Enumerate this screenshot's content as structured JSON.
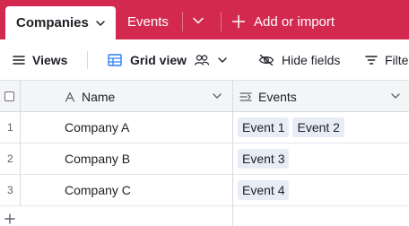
{
  "tabs": {
    "active_label": "Companies",
    "second_label": "Events",
    "add_import_label": "Add or import"
  },
  "toolbar": {
    "views_label": "Views",
    "grid_view_label": "Grid view",
    "hide_fields_label": "Hide fields",
    "filter_label": "Filte"
  },
  "table": {
    "columns": [
      {
        "label": "Name",
        "icon": "text-field-icon"
      },
      {
        "label": "Events",
        "icon": "linked-record-icon"
      }
    ],
    "rows": [
      {
        "num": "1",
        "name": "Company A",
        "events": [
          "Event 1",
          "Event 2"
        ]
      },
      {
        "num": "2",
        "name": "Company B",
        "events": [
          "Event 3"
        ]
      },
      {
        "num": "3",
        "name": "Company C",
        "events": [
          "Event 4"
        ]
      }
    ]
  },
  "colors": {
    "brand": "#d3294f",
    "chip_bg": "#e7ecf6",
    "header_bg": "#f4f5f7"
  }
}
